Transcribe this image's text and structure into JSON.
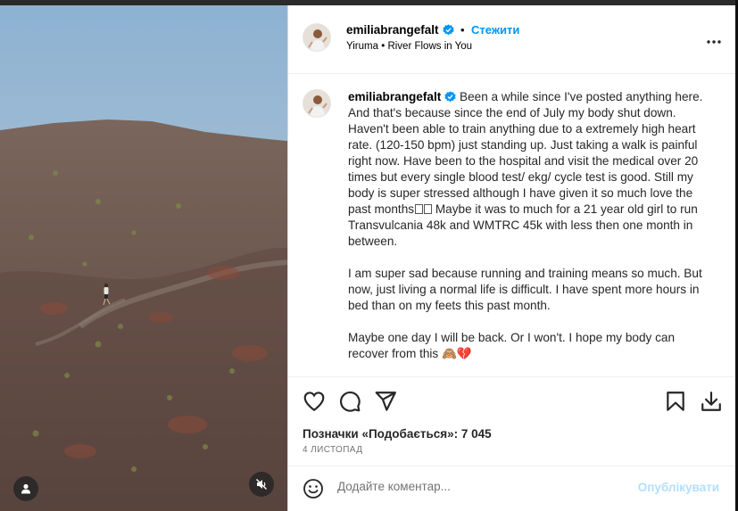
{
  "post": {
    "username": "emiliabrangefalt",
    "follow_label": "Стежити",
    "header_separator": "•",
    "audio": {
      "artist": "Yiruma",
      "separator": "•",
      "track": "River Flows in You"
    },
    "caption": {
      "p1": "Been a while since I've posted anything here. And that's because since the end of July my body shut down. Haven't been able to train anything due to a extremely high heart rate. (120-150 bpm) just standing up. Just taking a walk is painful right now. Have been to the hospital and visit the medical over 20 times but every single blood test/ ekg/ cycle test is good. Still my body is super stressed although I have given it so much love the past months",
      "p1b": " Maybe it was to much for a 21 year old girl to run Transvulcania 48k and WMTRC 45k with less then one month in between.",
      "p2": "I am super sad because running and training means so much. But now, just living a normal life is difficult. I have spent more hours in bed than on my feets this past month.",
      "p3": "Maybe one day I will be back. Or I won't. I hope my body can recover from this 🙈💔"
    },
    "likes": {
      "label": "Позначки «Подобається»: ",
      "count": "7 045"
    },
    "date": "4 ЛИСТОПАД"
  },
  "comment": {
    "placeholder": "Додайте коментар...",
    "post_label": "Опублікувати"
  },
  "icons": {
    "header": [
      "verified-badge-icon",
      "more-options-icon"
    ],
    "actions": [
      "heart-icon",
      "comment-icon",
      "share-icon",
      "bookmark-icon",
      "download-icon"
    ],
    "media": [
      "user-tag-icon",
      "mute-icon"
    ],
    "comment": [
      "emoji-icon"
    ]
  },
  "colors": {
    "accent": "#0095f6",
    "verified": "#0095f6",
    "post_disabled": "#b2dffc",
    "heart_emoji": "#c1272d"
  }
}
